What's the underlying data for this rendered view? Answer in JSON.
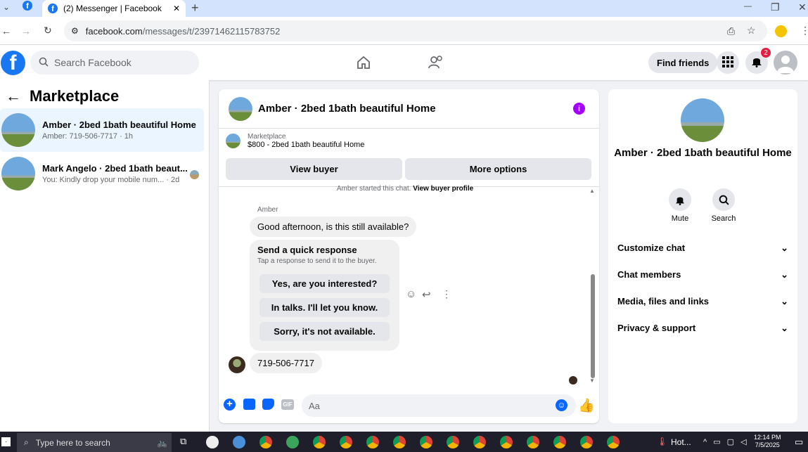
{
  "browser": {
    "tab_title": "(2) Messenger | Facebook",
    "tab_close": "✕",
    "new_tab": "+",
    "url_host": "facebook.com",
    "url_path": "/messages/t/23971462115783752",
    "window_controls": [
      "—",
      "❐",
      "✕"
    ]
  },
  "facebook": {
    "logo_letter": "f",
    "search_placeholder": "Search Facebook",
    "find_friends": "Find friends",
    "notifications_count": "2"
  },
  "sidebar": {
    "title": "Marketplace",
    "conversations": [
      {
        "name": "Amber · 2bed 1bath beautiful Home",
        "preview": "Amber: 719-506-7717 · 1h"
      },
      {
        "name": "Mark Angelo · 2bed 1bath beaut...",
        "preview": "You: Kindly drop your mobile num... · 2d"
      }
    ]
  },
  "chat": {
    "header_title": "Amber · 2bed 1bath beautiful Home",
    "info_glyph": "i",
    "listing_source": "Marketplace",
    "listing_title": "$800 - 2bed 1bath beautiful Home",
    "view_buyer": "View buyer",
    "more_options": "More options",
    "started_text": "Amber started this chat.",
    "view_buyer_profile": "View buyer profile",
    "sender_name": "Amber",
    "message_1": "Good afternoon, is this still available?",
    "quick_title": "Send a quick response",
    "quick_subtitle": "Tap a response to send it to the buyer.",
    "quick_replies": [
      "Yes, are you interested?",
      "In talks. I'll let you know.",
      "Sorry, it's not available."
    ],
    "message_2": "719-506-7717",
    "composer_placeholder": "Aa",
    "gif_label": "GIF"
  },
  "details": {
    "name": "Amber · 2bed 1bath beautiful Home",
    "mute_label": "Mute",
    "search_label": "Search",
    "sections": [
      "Customize chat",
      "Chat members",
      "Media, files and links",
      "Privacy & support"
    ]
  },
  "taskbar": {
    "search_placeholder": "Type here to search",
    "weather": "Hot...",
    "time": "12:14 PM",
    "date": "7/5/2025"
  },
  "colors": {
    "facebook_blue": "#1877f2",
    "notification_red": "#e41e3f",
    "info_purple": "#a300ff"
  }
}
